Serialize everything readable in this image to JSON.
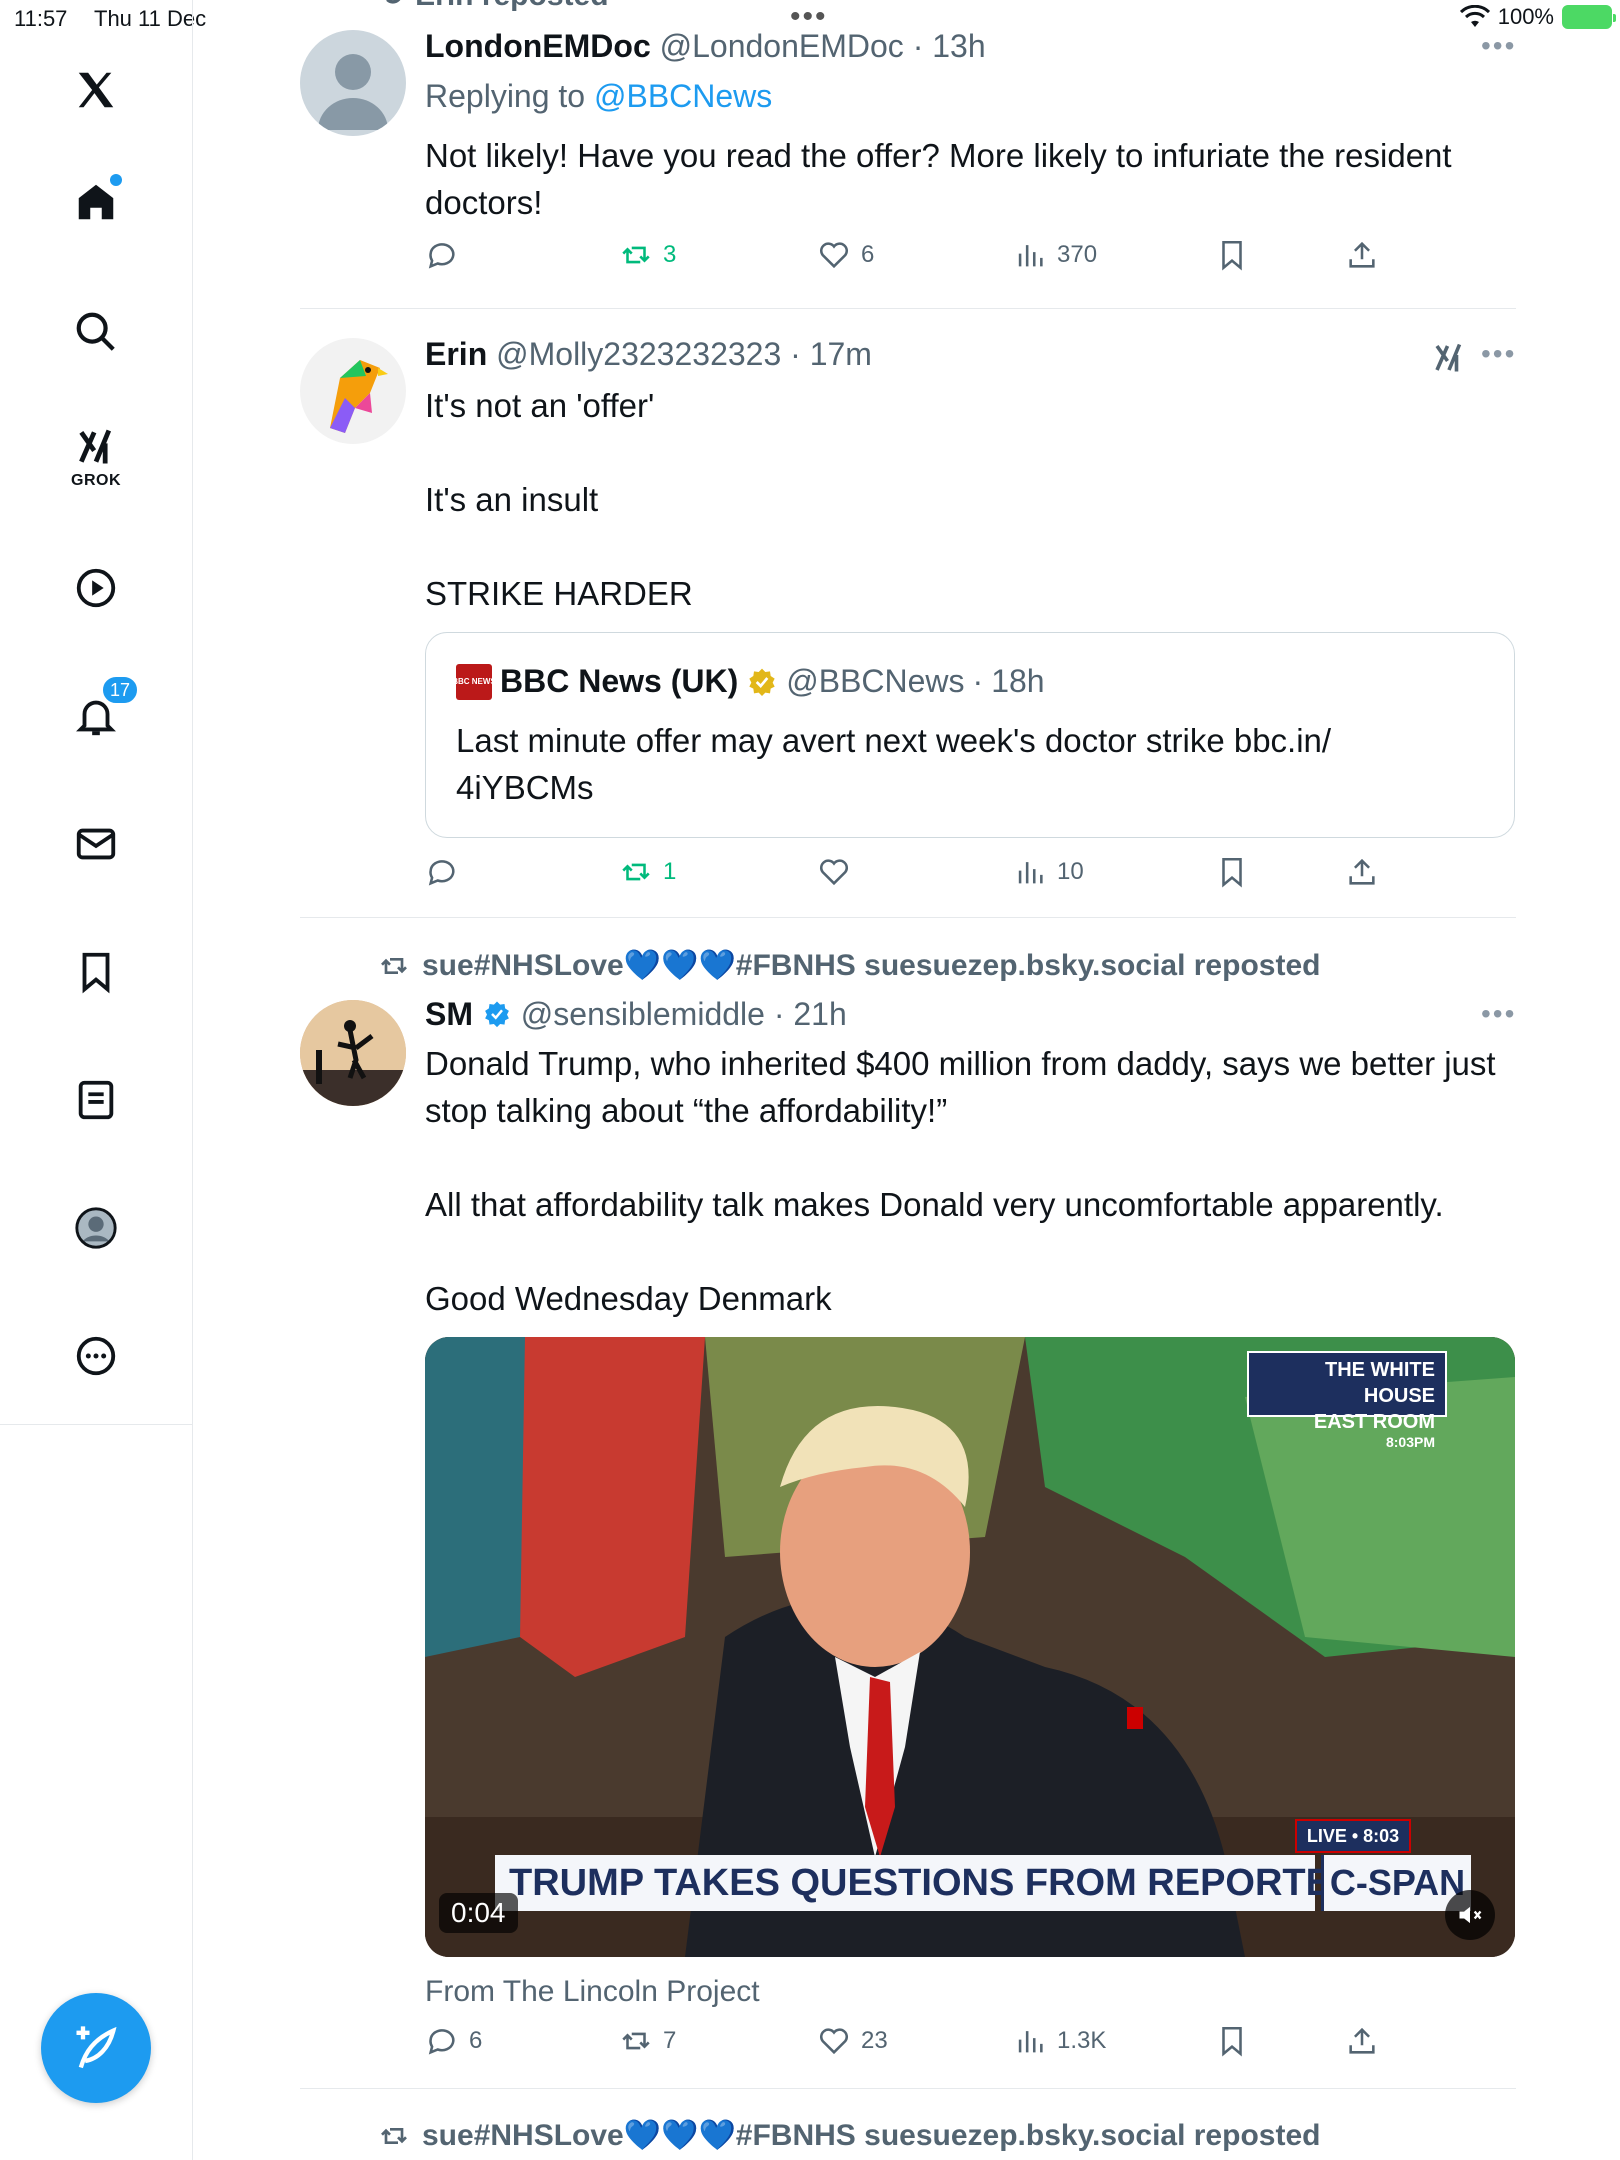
{
  "status_bar": {
    "time": "11:57",
    "date": "Thu 11 Dec",
    "battery": "100%"
  },
  "sidebar": {
    "grok_label": "GROK",
    "notifications_badge": "17"
  },
  "partial_top": {
    "repost_text": "Erin reposted"
  },
  "tweets": [
    {
      "name": "LondonEMDoc",
      "handle": "@LondonEMDoc",
      "time": "13h",
      "replying_prefix": "Replying to",
      "replying_to": "@BBCNews",
      "text": "Not likely! Have you read the offer? More likely to infuriate the resident doctors!",
      "replies": "",
      "reposts": "3",
      "likes": "6",
      "views": "370"
    },
    {
      "name": "Erin",
      "handle": "@Molly2323232323",
      "time": "17m",
      "text": "It's not an 'offer'\n\nIt's an insult\n\nSTRIKE HARDER",
      "quote": {
        "logo_text": "BBC NEWS",
        "name": "BBC News (UK)",
        "handle": "@BBCNews",
        "time": "18h",
        "text": "Last minute offer may avert next week's doctor strike bbc.in/\n4iYBCMs"
      },
      "replies": "",
      "reposts": "1",
      "likes": "",
      "views": "10"
    },
    {
      "repost_by": "sue#NHSLove💙💙💙#FBNHS suesuezep.bsky.social reposted",
      "name": "SM",
      "handle": "@sensiblemiddle",
      "time": "21h",
      "text": "Donald Trump, who inherited $400 million from daddy, says we better just stop talking about “the affordability!”\n\nAll that affordability talk makes Donald very uncomfortable apparently.\n\nGood Wednesday Denmark",
      "media": {
        "banner": "TRUMP TAKES QUESTIONS FROM REPORTERS",
        "network": "C-SPAN",
        "live": "LIVE • 8:03",
        "location_line1": "THE WHITE HOUSE",
        "location_line2": "EAST ROOM",
        "location_time": "8:03PM",
        "duration": "0:04"
      },
      "media_source": "From The Lincoln Project",
      "replies": "6",
      "reposts": "7",
      "likes": "23",
      "views": "1.3K"
    }
  ],
  "next_repost": "sue#NHSLove💙💙💙#FBNHS suesuezep.bsky.social reposted",
  "colors": {
    "accent": "#1d9bf0",
    "repost_green": "#00ba7c",
    "muted": "#536471"
  }
}
